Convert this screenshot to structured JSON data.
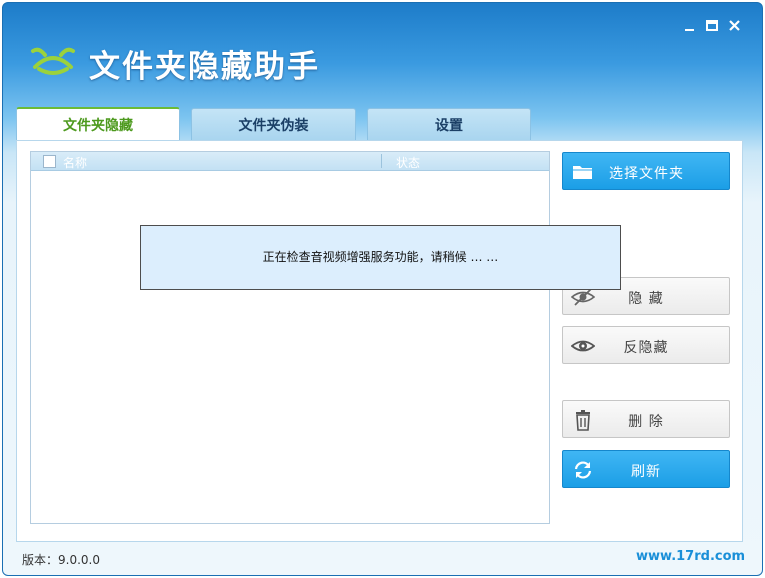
{
  "app": {
    "title": "文件夹隐藏助手",
    "version": "版本：9.0.0.0",
    "website": "www.17rd.com"
  },
  "window_controls": [
    "minimize",
    "maximize",
    "close"
  ],
  "tabs": [
    {
      "label": "文件夹隐藏",
      "active": true
    },
    {
      "label": "文件夹伪装",
      "active": false
    },
    {
      "label": "设置",
      "active": false
    }
  ],
  "list": {
    "columns": [
      "名称",
      "状态"
    ],
    "rows": []
  },
  "buttons": {
    "select_folder": "选择文件夹",
    "hide": "隐 藏",
    "unhide": "反隐藏",
    "delete": "删 除",
    "refresh": "刷新"
  },
  "dialog": {
    "message": "正在检查音视频增强服务功能，请稍候 … …"
  },
  "colors": {
    "title_bar": "#1d7cc9",
    "active_tab_text": "#4d9a1e",
    "primary_button": "#1b9ee6",
    "website_link": "#1a8fd8"
  }
}
